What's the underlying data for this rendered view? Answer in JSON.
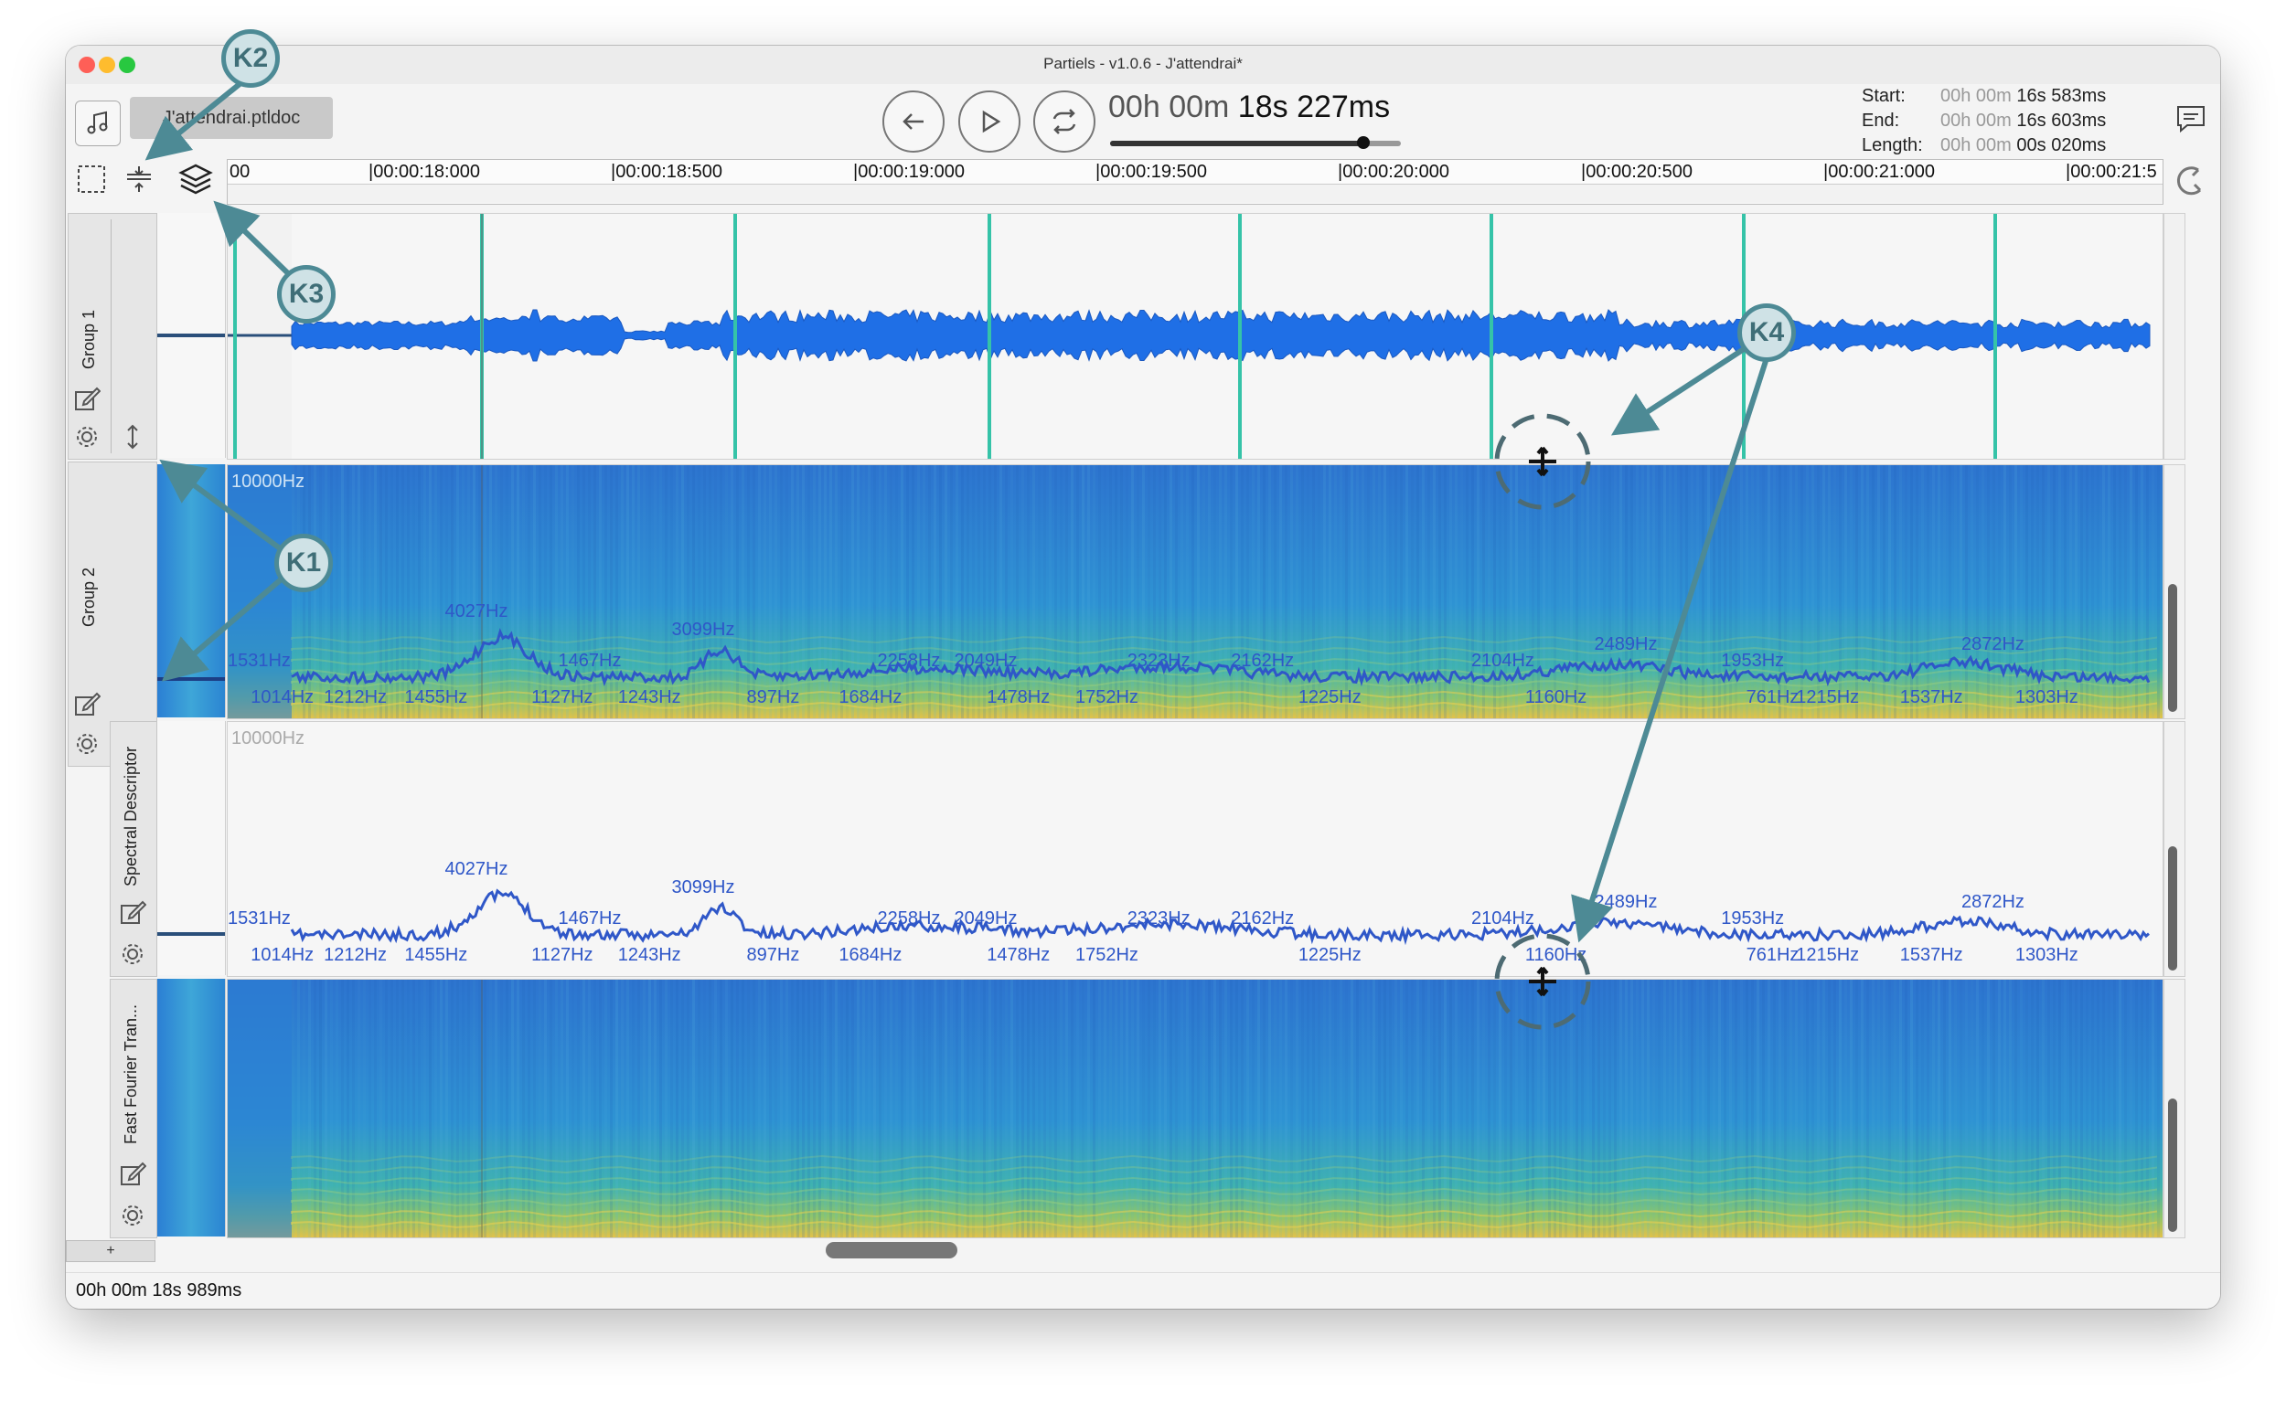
{
  "window": {
    "title": "Partiels - v1.0.6 - J'attendrai*"
  },
  "toolbar": {
    "document_tab": "J'attendrai.ptldoc",
    "time_display": {
      "hours": "00h",
      "minutes": "00m",
      "seconds": "18s",
      "milliseconds": "227ms"
    },
    "playhead_progress": 0.87
  },
  "selection": {
    "start_label": "Start:",
    "start_hm": "00h 00m",
    "start_s": "16s 583ms",
    "end_label": "End:",
    "end_hm": "00h 00m",
    "end_s": "16s 603ms",
    "length_label": "Length:",
    "length_hm": "00h 00m",
    "length_s": "00s 020ms"
  },
  "ruler": {
    "labels": [
      "00",
      "|00:00:18:000",
      "|00:00:18:500",
      "|00:00:19:000",
      "|00:00:19:500",
      "|00:00:20:000",
      "|00:00:20:500",
      "|00:00:21:000",
      "|00:00:21:5"
    ]
  },
  "groups": [
    {
      "name": "Group 1"
    },
    {
      "name": "Group 2"
    }
  ],
  "tracks": [
    {
      "name": "Spectral Descriptor"
    },
    {
      "name": "Fast Fourier Tran..."
    }
  ],
  "spectrogram": {
    "top_label": "10000Hz"
  },
  "descriptor_top_label": "10000Hz",
  "pitch_labels": [
    {
      "text": "1531Hz",
      "t": 0.0
    },
    {
      "text": "1014Hz",
      "t": 0.012
    },
    {
      "text": "1212Hz",
      "t": 0.05
    },
    {
      "text": "1455Hz",
      "t": 0.092
    },
    {
      "text": "4027Hz",
      "t": 0.113
    },
    {
      "text": "1127Hz",
      "t": 0.158
    },
    {
      "text": "1467Hz",
      "t": 0.172
    },
    {
      "text": "1243Hz",
      "t": 0.203
    },
    {
      "text": "3099Hz",
      "t": 0.231
    },
    {
      "text": "897Hz",
      "t": 0.27
    },
    {
      "text": "1684Hz",
      "t": 0.318
    },
    {
      "text": "2258Hz",
      "t": 0.338
    },
    {
      "text": "2049Hz",
      "t": 0.378
    },
    {
      "text": "1478Hz",
      "t": 0.395
    },
    {
      "text": "1752Hz",
      "t": 0.441
    },
    {
      "text": "2323Hz",
      "t": 0.468
    },
    {
      "text": "2162Hz",
      "t": 0.522
    },
    {
      "text": "1225Hz",
      "t": 0.557
    },
    {
      "text": "2104Hz",
      "t": 0.647
    },
    {
      "text": "1160Hz",
      "t": 0.675
    },
    {
      "text": "2489Hz",
      "t": 0.711
    },
    {
      "text": "1953Hz",
      "t": 0.777
    },
    {
      "text": "761Hz",
      "t": 0.79
    },
    {
      "text": "1215Hz",
      "t": 0.816
    },
    {
      "text": "1537Hz",
      "t": 0.87
    },
    {
      "text": "2872Hz",
      "t": 0.902
    },
    {
      "text": "1303Hz",
      "t": 0.93
    }
  ],
  "callouts": {
    "k1": "K1",
    "k2": "K2",
    "k3": "K3",
    "k4": "K4"
  },
  "status": {
    "time": "00h 00m 18s 989ms"
  },
  "colors": {
    "accent": "#4d8a95",
    "waveform": "#1f6fe6",
    "markers": "#35c3a8",
    "curve": "#2f57c8"
  },
  "icons": [
    "music-note-icon",
    "back-icon",
    "play-icon",
    "loop-icon",
    "chat-icon",
    "selection-icon",
    "resize-icon",
    "layers-icon",
    "magnet-icon",
    "edit-icon",
    "gear-icon"
  ]
}
